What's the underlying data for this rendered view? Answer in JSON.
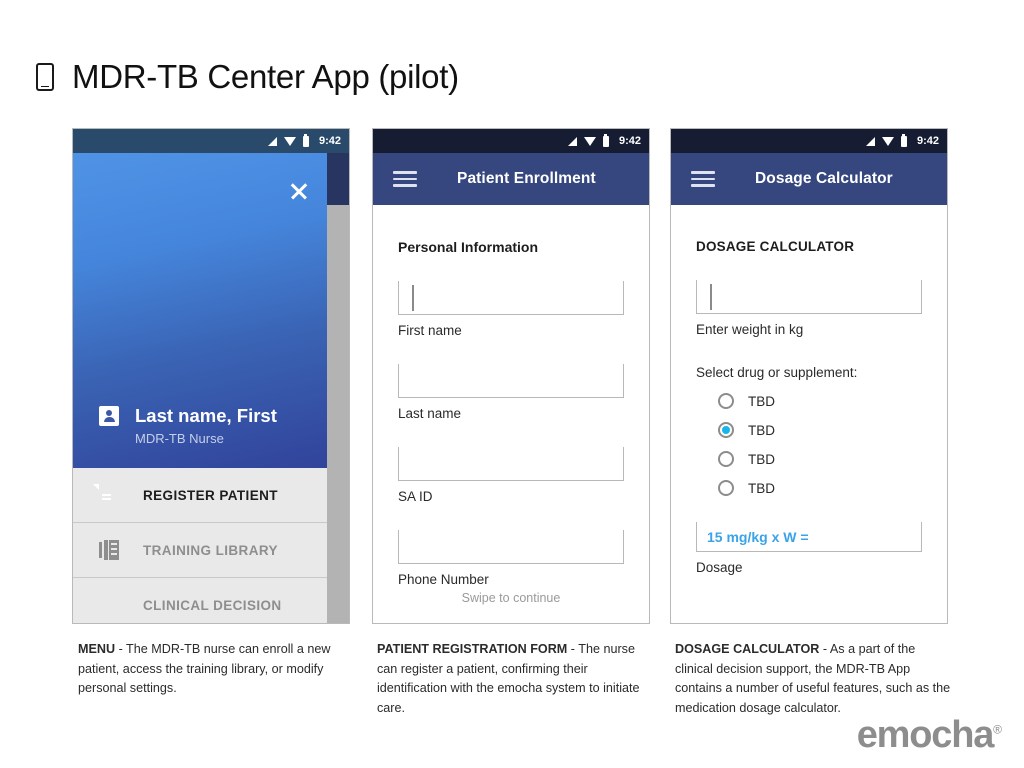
{
  "page": {
    "title": "MDR-TB Center App (pilot)",
    "title_icon": "phone-icon"
  },
  "status_bar": {
    "time": "9:42",
    "icons": [
      "signal-icon",
      "wifi-icon",
      "battery-icon"
    ]
  },
  "phones": [
    {
      "id": "menu",
      "drawer": {
        "close_icon": "close-icon",
        "avatar_icon": "avatar-icon",
        "user_name": "Last name, First",
        "user_role": "MDR-TB Nurse",
        "items": [
          {
            "label": "REGISTER PATIENT",
            "icon": "document-icon",
            "state": "active"
          },
          {
            "label": "TRAINING LIBRARY",
            "icon": "library-icon",
            "state": "dim"
          },
          {
            "label": "CLINICAL DECISION",
            "icon": "plus-icon",
            "state": "dim"
          }
        ]
      }
    },
    {
      "id": "enrollment",
      "appbar": {
        "menu_icon": "hamburger-icon",
        "title": "Patient Enrollment"
      },
      "section_title": "Personal Information",
      "fields": [
        {
          "label": "First name",
          "value": "",
          "focused": true
        },
        {
          "label": "Last name",
          "value": "",
          "focused": false
        },
        {
          "label": "SA ID",
          "value": "",
          "focused": false
        },
        {
          "label": "Phone Number",
          "value": "",
          "focused": false
        }
      ],
      "footer_note": "Swipe to continue"
    },
    {
      "id": "dosage",
      "appbar": {
        "menu_icon": "hamburger-icon",
        "title": "Dosage Calculator"
      },
      "calc_title": "DOSAGE CALCULATOR",
      "weight_field": {
        "label": "Enter weight in kg",
        "value": "",
        "focused": true
      },
      "select_label": "Select drug or supplement:",
      "options": [
        {
          "label": "TBD",
          "selected": false
        },
        {
          "label": "TBD",
          "selected": true
        },
        {
          "label": "TBD",
          "selected": false
        },
        {
          "label": "TBD",
          "selected": false
        }
      ],
      "result": {
        "value": "15 mg/kg x W =",
        "caption": "Dosage"
      }
    }
  ],
  "captions": [
    {
      "lead": "MENU",
      "body": " - The MDR-TB nurse can enroll a new patient, access the training library, or modify personal settings."
    },
    {
      "lead": "PATIENT REGISTRATION FORM",
      "body": " - The nurse can register a patient, confirming their identification with the emocha system to initiate care."
    },
    {
      "lead": "DOSAGE CALCULATOR",
      "body": " - As a part of the clinical decision support, the MDR-TB App contains a number of useful features, such as the medication dosage calculator."
    }
  ],
  "logo": {
    "text": "emocha",
    "mark": "®"
  },
  "colors": {
    "appbar": "#36477f",
    "statusbar": "#161d33",
    "statusbar_light": "#2a4a6b",
    "drawer_top": "#4f93e6",
    "drawer_bottom": "#31439a",
    "accent_cyan": "#18b5e8",
    "result_blue": "#3aa3e8",
    "logo_gray": "#8d8d8d"
  }
}
